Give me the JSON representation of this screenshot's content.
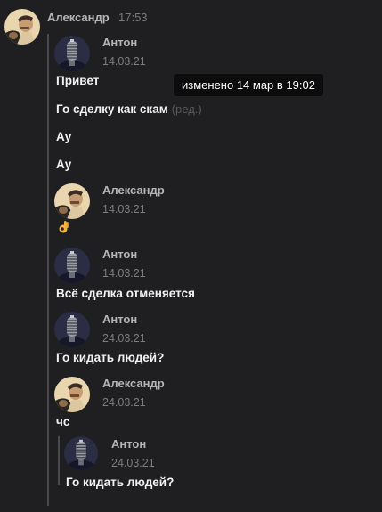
{
  "header": {
    "author": "Александр",
    "time": "17:53",
    "avatar_icon": "man-portrait-avatar-icon"
  },
  "tooltip": "изменено 14 мар в 19:02",
  "messages": [
    {
      "author": "Антон",
      "date": "14.03.21",
      "avatar_icon": "microphone-avatar-icon",
      "lines": [
        "Привет",
        "Го сделку как скам",
        "Ау",
        "Ау"
      ],
      "edited_label": "(ред.)"
    },
    {
      "author": "Александр",
      "date": "14.03.21",
      "avatar_icon": "man-portrait-avatar-icon",
      "emoji": "👌"
    },
    {
      "author": "Антон",
      "date": "14.03.21",
      "avatar_icon": "microphone-avatar-icon",
      "lines": [
        "Всё сделка отменяется"
      ]
    },
    {
      "author": "Антон",
      "date": "24.03.21",
      "avatar_icon": "microphone-avatar-icon",
      "lines": [
        "Го кидать людей?"
      ]
    },
    {
      "author": "Александр",
      "date": "24.03.21",
      "avatar_icon": "man-portrait-avatar-icon",
      "lines": [
        "чс"
      ]
    }
  ],
  "nested": {
    "author": "Антон",
    "date": "24.03.21",
    "avatar_icon": "microphone-avatar-icon",
    "text": "Го кидать людей?"
  },
  "colors": {
    "background": "#1f1f22",
    "thread_line": "#4a4a4d",
    "tooltip_bg": "#0c0c0d"
  }
}
